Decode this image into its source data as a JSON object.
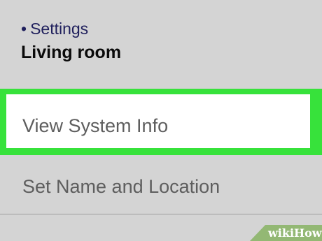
{
  "header": {
    "breadcrumb_bullet": "•",
    "breadcrumb_label": "Settings",
    "title": "Living room"
  },
  "menu": {
    "items": [
      {
        "label": "View System Info",
        "highlighted": true
      },
      {
        "label": "Set Name and Location",
        "highlighted": false
      }
    ]
  },
  "watermark": {
    "part1": "wiki",
    "part2": "How"
  },
  "colors": {
    "background": "#d4d4d4",
    "highlight_border": "#37e23b",
    "breadcrumb_text": "#1f1f5c",
    "watermark_bg": "#93b874"
  }
}
